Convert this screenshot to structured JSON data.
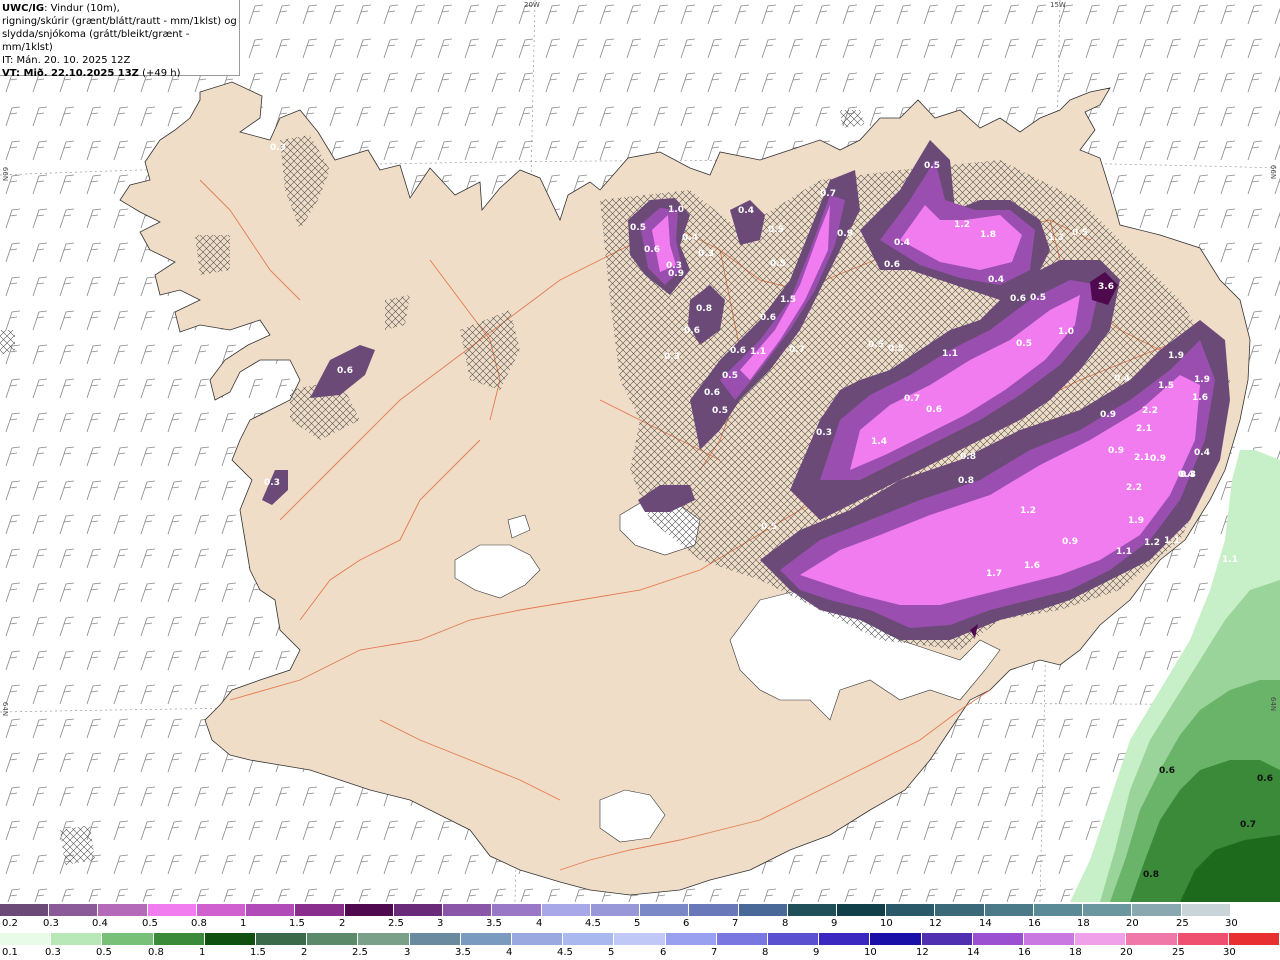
{
  "header": {
    "line1_bold": "UWC/IG",
    "line1_rest": ": Vindur (10m),",
    "line2": "rigning/skúrir (grænt/blátt/rautt - mm/1klst) og",
    "line3": "slydda/snjókoma (grátt/bleikt/grænt - mm/1klst)",
    "line4": "IT: Mán. 20. 10. 2025 12Z",
    "line5_bold": "VT: Mið. 22.10.2025 13Z",
    "line5_rest": " (+49 h)"
  },
  "grid_labels": {
    "lon_20w": "20W",
    "lon_15w": "15W",
    "lat_66n_left": "66N",
    "lat_66n_right": "66N",
    "lat_64n_left": "64N",
    "lat_64n_right": "64N"
  },
  "colors": {
    "land": "#f0ddc8",
    "glacier": "#ffffff",
    "roads": "#e06a3a",
    "sea": "#ffffff",
    "snow_light": "#6b4a78",
    "snow_mid": "#9a4fb0",
    "snow_high": "#f07cf0",
    "rain_light": "#c8f0c8",
    "rain_mid": "#6ab46a",
    "rain_dark": "#1d6a1d"
  },
  "snow_values": [
    "0.3",
    "0.6",
    "0.3",
    "1.0",
    "0.5",
    "0.4",
    "0.6",
    "0.9",
    "0.4",
    "0.3",
    "0.8",
    "0.5",
    "0.3",
    "0.6",
    "0.5",
    "0.6",
    "1.1",
    "0.7",
    "0.5",
    "0.6",
    "0.5",
    "0.7",
    "0.9",
    "0.5",
    "0.4",
    "0.6",
    "1.5",
    "0.5",
    "0.6",
    "0.3",
    "1.2",
    "1.8",
    "0.5",
    "0.6",
    "1.3",
    "0.4",
    "0.5",
    "3.6",
    "1.0",
    "0.5",
    "0.5",
    "1.1",
    "0.7",
    "0.6",
    "0.3",
    "1.4",
    "0.4",
    "1.9",
    "1.5",
    "1.9",
    "1.6",
    "2.2",
    "2.1",
    "0.9",
    "0.9",
    "0.8",
    "0.8",
    "2.1",
    "0.9",
    "0.4",
    "0.3",
    "2.2",
    "1.9",
    "0.4",
    "0.5",
    "1.2",
    "1.1",
    "1.2",
    "1.1",
    "1.1",
    "1.1",
    "1.7",
    "1.6",
    "0.9"
  ],
  "rain_values": [
    "0.6",
    "0.6",
    "0.7",
    "0.8"
  ],
  "legend_snow": [
    "0.2",
    "0.3",
    "0.4",
    "0.5",
    "0.8",
    "1",
    "1.5",
    "2",
    "2.5",
    "3",
    "3.5",
    "4",
    "4.5",
    "5",
    "6",
    "7",
    "8",
    "9",
    "10",
    "12",
    "14",
    "16",
    "18",
    "20",
    "25",
    "30"
  ],
  "legend_rain": [
    "0.1",
    "0.3",
    "0.5",
    "0.8",
    "1",
    "1.5",
    "2",
    "2.5",
    "3",
    "3.5",
    "4",
    "4.5",
    "5",
    "6",
    "7",
    "8",
    "9",
    "10",
    "12",
    "14",
    "16",
    "18",
    "20",
    "25",
    "30"
  ],
  "legend_snow_colors": [
    "#6b4a78",
    "#8b5a98",
    "#b46ab8",
    "#f07cf0",
    "#d05fd0",
    "#b04bb8",
    "#8a2e8e",
    "#4f0a4f",
    "#6a2a7a",
    "#8a56a8",
    "#9a78c8",
    "#a8a8e8",
    "#9898d8",
    "#7a88c8",
    "#6878b8",
    "#4a6898",
    "#204f5a",
    "#103f4a",
    "#2a5a6a",
    "#3a6a7a",
    "#4a7a88",
    "#5a8a96",
    "#6a96a0",
    "#8aa8b0",
    "#c8d4d8",
    "#ffffff"
  ],
  "legend_rain_colors": [
    "#e8fae8",
    "#b8e8b8",
    "#78c078",
    "#3a8a3a",
    "#0f4f0f",
    "#3a6a4a",
    "#5a8a6a",
    "#7aa08a",
    "#6a8aa0",
    "#7a9ac0",
    "#9aaae0",
    "#aab8f0",
    "#c0c8f8",
    "#9aa0f0",
    "#7a78e0",
    "#5a50d0",
    "#3a28c0",
    "#1a10a8",
    "#5030b0",
    "#9a50d0",
    "#c878e0",
    "#f0a0e8",
    "#f078a8",
    "#f05070",
    "#e83030"
  ]
}
